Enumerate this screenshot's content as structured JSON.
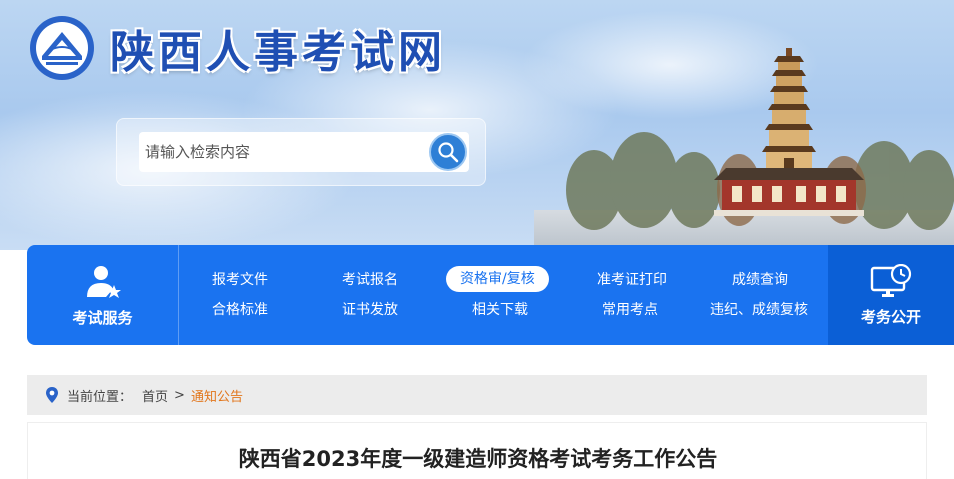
{
  "site": {
    "title": "陕西人事考试网"
  },
  "search": {
    "placeholder": "请输入检索内容",
    "button_icon": "search-icon"
  },
  "nav": {
    "left_label": "考试服务",
    "left_icon": "user-star-icon",
    "right_label": "考务公开",
    "right_icon": "monitor-clock-icon",
    "row1": [
      "报考文件",
      "考试报名",
      "资格审/复核",
      "准考证打印",
      "成绩查询"
    ],
    "row2": [
      "合格标准",
      "证书发放",
      "相关下载",
      "常用考点",
      "违纪、成绩复核"
    ],
    "active_item": "资格审/复核"
  },
  "breadcrumb": {
    "prefix": "当前位置：",
    "home": "首页",
    "separator": ">",
    "current": "通知公告"
  },
  "article": {
    "title": "陕西省2023年度一级建造师资格考试考务工作公告"
  },
  "colors": {
    "primary": "#1a73f0",
    "primary_dark": "#0b5fd6",
    "title_blue": "#1f4fb3",
    "breadcrumb_current": "#e2761c"
  }
}
